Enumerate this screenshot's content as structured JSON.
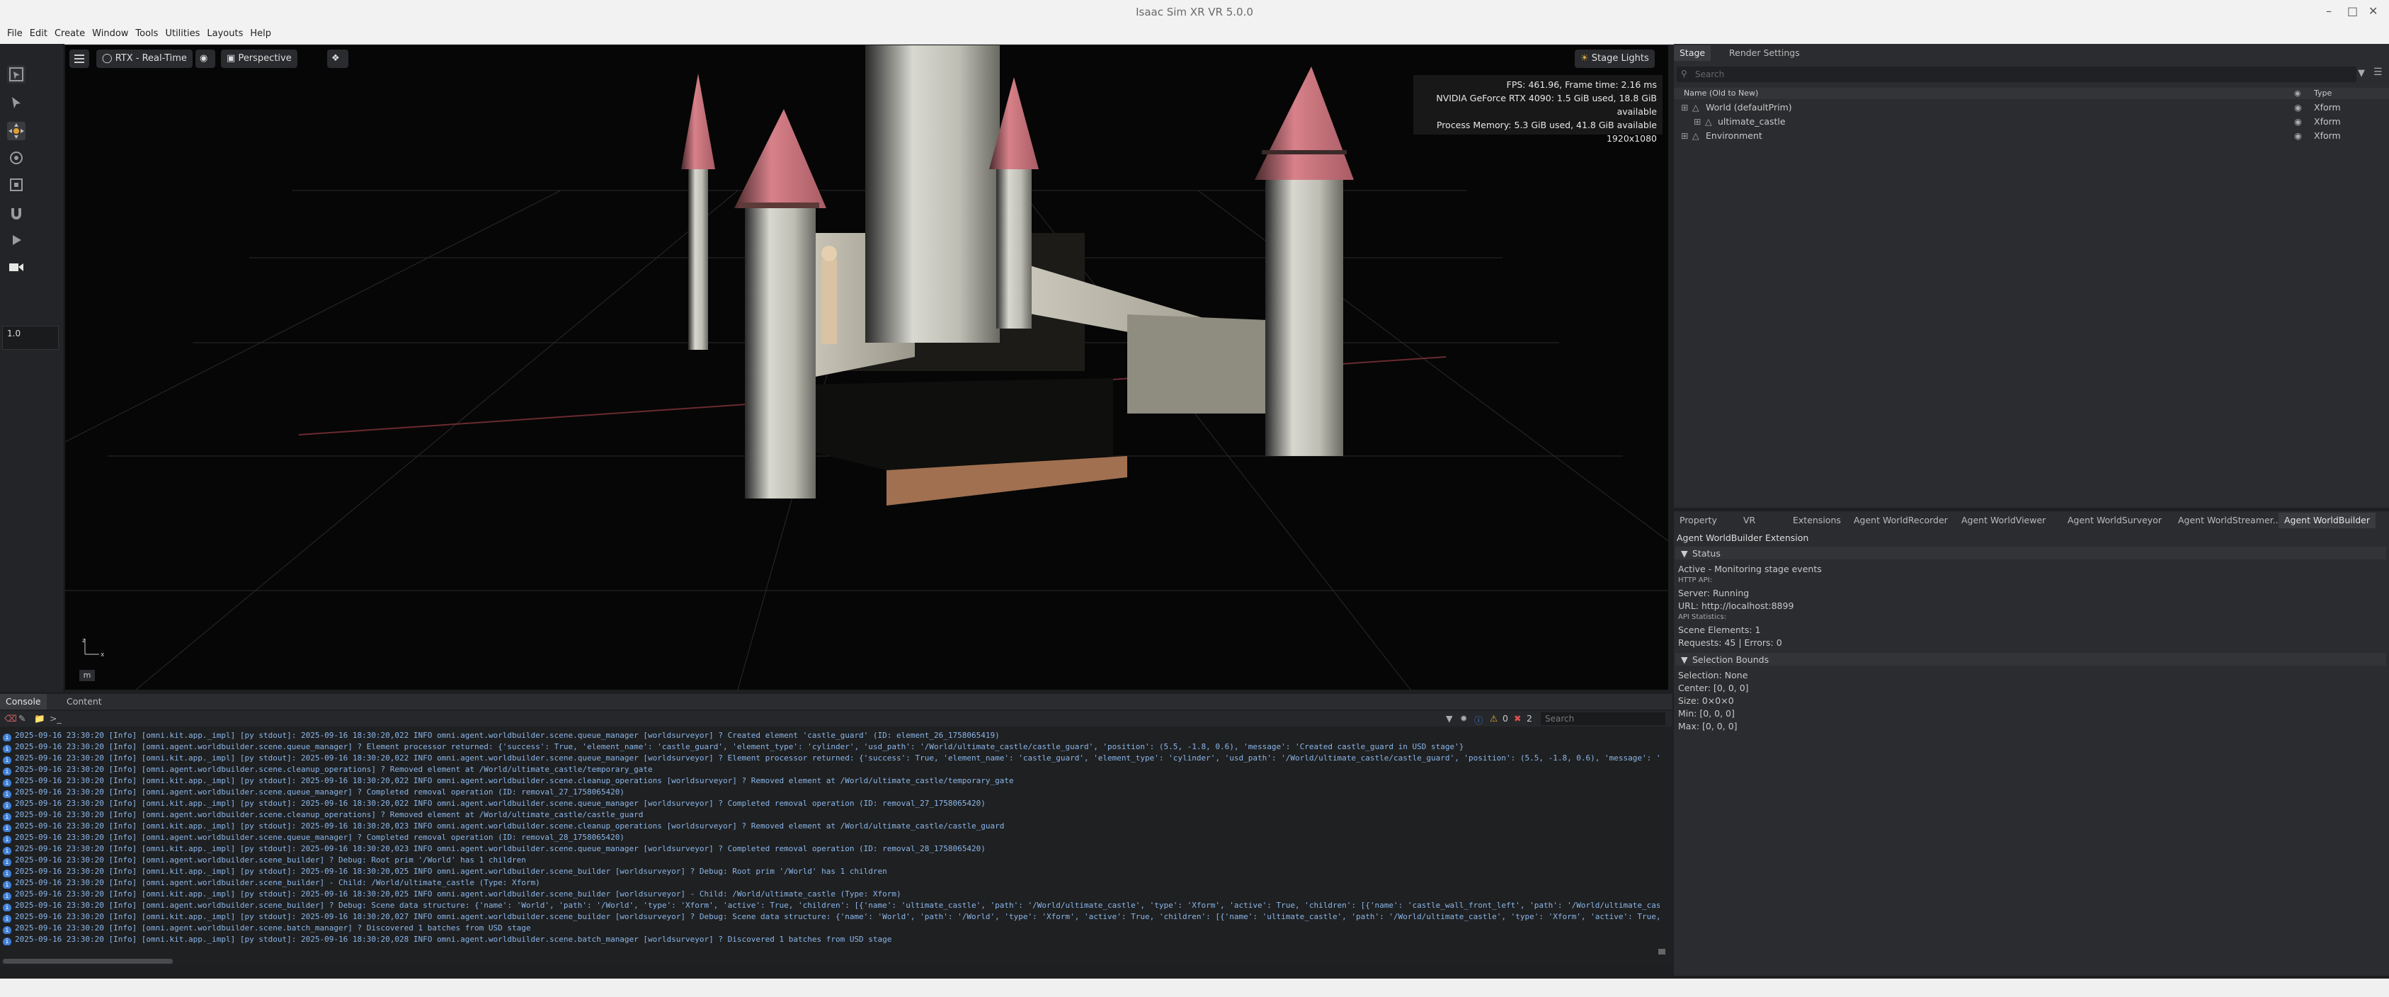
{
  "window": {
    "title": "Isaac Sim XR VR 5.0.0"
  },
  "menu": [
    "File",
    "Edit",
    "Create",
    "Window",
    "Tools",
    "Utilities",
    "Layouts",
    "Help"
  ],
  "left_toolbar": {
    "tools": [
      "select-mode-icon",
      "select-icon",
      "move-icon",
      "rotate-icon",
      "scale-icon",
      "snap-icon",
      "play-icon",
      "camera-icon"
    ],
    "speed_value": "1.0"
  },
  "viewport": {
    "render_mode": "RTX - Real-Time",
    "camera": "Perspective",
    "lights": "Stage Lights",
    "stats": [
      "FPS: 461.96, Frame time: 2.16 ms",
      "NVIDIA GeForce RTX 4090: 1.5 GiB used, 18.8 GiB available",
      "Process Memory: 5.3 GiB used, 41.8 GiB available",
      "1920x1080"
    ],
    "axis_label": "m",
    "axis": {
      "x": "x",
      "z": "z"
    }
  },
  "stage": {
    "tabs": [
      "Stage",
      "Render Settings"
    ],
    "search_placeholder": "Search",
    "columns": {
      "name": "Name (Old to New)",
      "type": "Type"
    },
    "items": [
      {
        "name": "World (defaultPrim)",
        "type": "Xform"
      },
      {
        "name": "ultimate_castle",
        "type": "Xform"
      },
      {
        "name": "Environment",
        "type": "Xform"
      }
    ]
  },
  "property_tabs": [
    "Property",
    "VR",
    "Extensions",
    "Agent WorldRecorder",
    "Agent WorldViewer",
    "Agent WorldSurveyor",
    "Agent WorldStreamer...",
    "Agent WorldBuilder"
  ],
  "extension": {
    "title": "Agent WorldBuilder Extension",
    "status_header": "Status",
    "status_lines": [
      "Active - Monitoring stage events",
      "HTTP API:",
      "Server: Running",
      "URL: http://localhost:8899",
      "API Statistics:",
      "Scene Elements: 1",
      "Requests: 45 | Errors: 0"
    ],
    "bounds_header": "Selection Bounds",
    "bounds_lines": [
      "Selection: None",
      "Center: [0, 0, 0]",
      "Size: 0×0×0",
      "Min: [0, 0, 0]",
      "Max: [0, 0, 0]"
    ]
  },
  "console": {
    "tabs": [
      "Console",
      "Content"
    ],
    "warn_count": "0",
    "error_count": "2",
    "search_placeholder": "Search",
    "lines": [
      "2025-09-16 23:30:20  [Info] [omni.kit.app._impl] [py stdout]: 2025-09-16 18:30:20,022 INFO omni.agent.worldbuilder.scene.queue_manager [worldsurveyor] ? Created element 'castle_guard' (ID: element_26_1758065419)",
      "2025-09-16 23:30:20  [Info] [omni.agent.worldbuilder.scene.queue_manager] ? Element processor returned: {'success': True, 'element_name': 'castle_guard', 'element_type': 'cylinder', 'usd_path': '/World/ultimate_castle/castle_guard', 'position': (5.5, -1.8, 0.6), 'message': 'Created castle_guard in USD stage'}",
      "2025-09-16 23:30:20  [Info] [omni.kit.app._impl] [py stdout]: 2025-09-16 18:30:20,022 INFO omni.agent.worldbuilder.scene.queue_manager [worldsurveyor] ? Element processor returned: {'success': True, 'element_name': 'castle_guard', 'element_type': 'cylinder', 'usd_path': '/World/ultimate_castle/castle_guard', 'position': (5.5, -1.8, 0.6), 'message': 'Created castle_guard in USD stage'}",
      "2025-09-16 23:30:20  [Info] [omni.agent.worldbuilder.scene.cleanup_operations] ? Removed element at /World/ultimate_castle/temporary_gate",
      "2025-09-16 23:30:20  [Info] [omni.kit.app._impl] [py stdout]: 2025-09-16 18:30:20,022 INFO omni.agent.worldbuilder.scene.cleanup_operations [worldsurveyor] ? Removed element at /World/ultimate_castle/temporary_gate",
      "2025-09-16 23:30:20  [Info] [omni.agent.worldbuilder.scene.queue_manager] ? Completed removal operation (ID: removal_27_1758065420)",
      "2025-09-16 23:30:20  [Info] [omni.kit.app._impl] [py stdout]: 2025-09-16 18:30:20,022 INFO omni.agent.worldbuilder.scene.queue_manager [worldsurveyor] ? Completed removal operation (ID: removal_27_1758065420)",
      "2025-09-16 23:30:20  [Info] [omni.agent.worldbuilder.scene.cleanup_operations] ? Removed element at /World/ultimate_castle/castle_guard",
      "2025-09-16 23:30:20  [Info] [omni.kit.app._impl] [py stdout]: 2025-09-16 18:30:20,023 INFO omni.agent.worldbuilder.scene.cleanup_operations [worldsurveyor] ? Removed element at /World/ultimate_castle/castle_guard",
      "2025-09-16 23:30:20  [Info] [omni.agent.worldbuilder.scene.queue_manager] ? Completed removal operation (ID: removal_28_1758065420)",
      "2025-09-16 23:30:20  [Info] [omni.kit.app._impl] [py stdout]: 2025-09-16 18:30:20,023 INFO omni.agent.worldbuilder.scene.queue_manager [worldsurveyor] ? Completed removal operation (ID: removal_28_1758065420)",
      "2025-09-16 23:30:20  [Info] [omni.agent.worldbuilder.scene_builder] ? Debug: Root prim '/World' has 1 children",
      "2025-09-16 23:30:20  [Info] [omni.kit.app._impl] [py stdout]: 2025-09-16 18:30:20,025 INFO omni.agent.worldbuilder.scene_builder [worldsurveyor] ? Debug: Root prim '/World' has 1 children",
      "2025-09-16 23:30:20  [Info] [omni.agent.worldbuilder.scene_builder]   - Child: /World/ultimate_castle (Type: Xform)",
      "2025-09-16 23:30:20  [Info] [omni.kit.app._impl] [py stdout]: 2025-09-16 18:30:20,025 INFO omni.agent.worldbuilder.scene_builder [worldsurveyor]   - Child: /World/ultimate_castle (Type: Xform)",
      "2025-09-16 23:30:20  [Info] [omni.agent.worldbuilder.scene_builder] ? Debug: Scene data structure: {'name': 'World', 'path': '/World', 'type': 'Xform', 'active': True, 'children': [{'name': 'ultimate_castle', 'path': '/World/ultimate_castle', 'type': 'Xform', 'active': True, 'children': [{'name': 'castle_wall_front_left', 'path': '/World/ultimate_castle/castle_wall_front_left', 'type': 'Cube', 'active': True, 'children': [], 'bounds': {",
      "2025-09-16 23:30:20  [Info] [omni.kit.app._impl] [py stdout]: 2025-09-16 18:30:20,027 INFO omni.agent.worldbuilder.scene_builder [worldsurveyor] ? Debug: Scene data structure: {'name': 'World', 'path': '/World', 'type': 'Xform', 'active': True, 'children': [{'name': 'ultimate_castle', 'path': '/World/ultimate_castle', 'type': 'Xform', 'active': True, 'children': [{'name': 'castle_wall_front_left', 'path': '/World/ultimate_cas",
      "2025-09-16 23:30:20  [Info] [omni.agent.worldbuilder.scene.batch_manager] ? Discovered 1 batches from USD stage",
      "2025-09-16 23:30:20  [Info] [omni.kit.app._impl] [py stdout]: 2025-09-16 18:30:20,028 INFO omni.agent.worldbuilder.scene.batch_manager [worldsurveyor] ? Discovered 1 batches from USD stage"
    ]
  },
  "colors": {
    "accent": "#3f7fd6",
    "tower_cone": "#d8818a",
    "active_tab": "#3a3b3f"
  }
}
